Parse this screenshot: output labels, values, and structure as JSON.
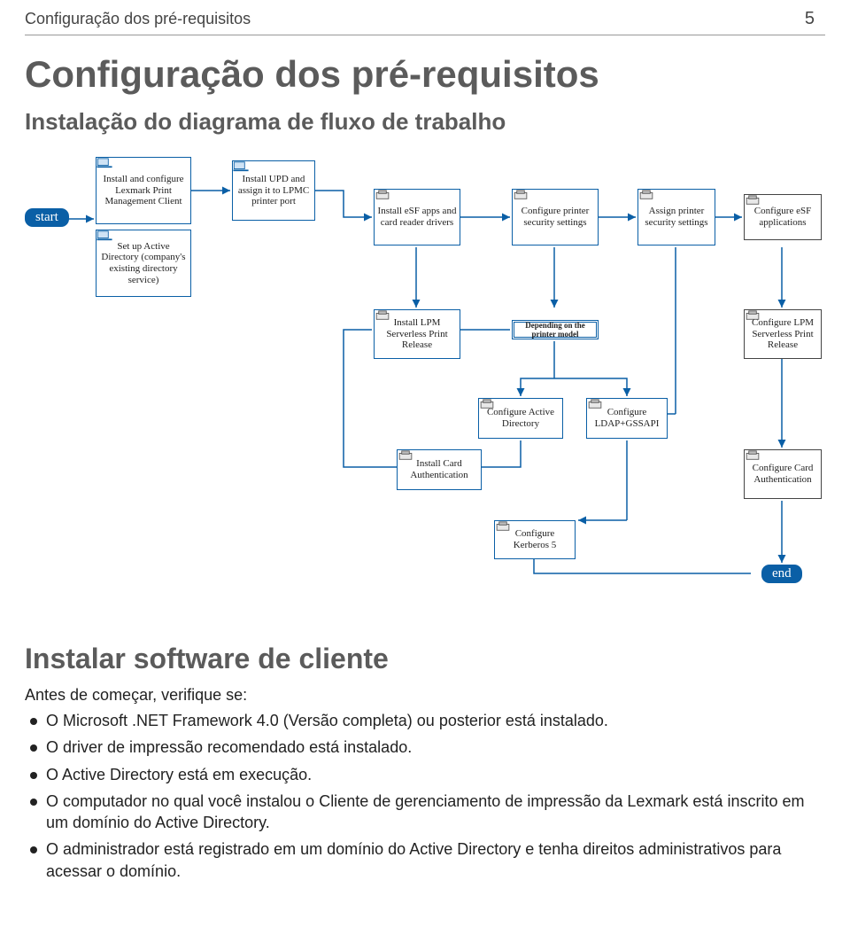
{
  "header": {
    "title": "Configuração dos pré-requisitos",
    "page_number": "5"
  },
  "h1": "Configuração dos pré-requisitos",
  "h2": "Instalação do diagrama de fluxo de trabalho",
  "diag": {
    "start": "start",
    "end": "end",
    "n1": "Install and configure Lexmark Print Management Client",
    "n2": "Set up Active Directory (company's existing directory service)",
    "n3": "Install UPD and assign it to LPMC printer port",
    "n4": "Install eSF apps and card reader drivers",
    "n5": "Configure printer security settings",
    "n6": "Assign printer security settings",
    "n7": "Configure eSF applications",
    "n8": "Install LPM Serverless Print Release",
    "n9": "Depending on the printer model",
    "n10": "Configure LPM Serverless Print Release",
    "n11": "Configure Active Directory",
    "n12": "Configure LDAP+GSSAPI",
    "n13": "Install Card Authentication",
    "n14": "Configure Card Authentication",
    "n15": "Configure Kerberos 5"
  },
  "section_title": "Instalar software de cliente",
  "lead": "Antes de começar, verifique se:",
  "bullets": [
    "O Microsoft .NET Framework 4.0 (Versão completa) ou posterior está instalado.",
    "O driver de impressão recomendado está instalado.",
    "O Active Directory está em execução.",
    "O computador no qual você instalou o Cliente de gerenciamento de impressão da Lexmark está inscrito em um domínio do Active Directory.",
    "O administrador está registrado em um domínio do Active Directory e tenha direitos administrativos para acessar o domínio."
  ]
}
